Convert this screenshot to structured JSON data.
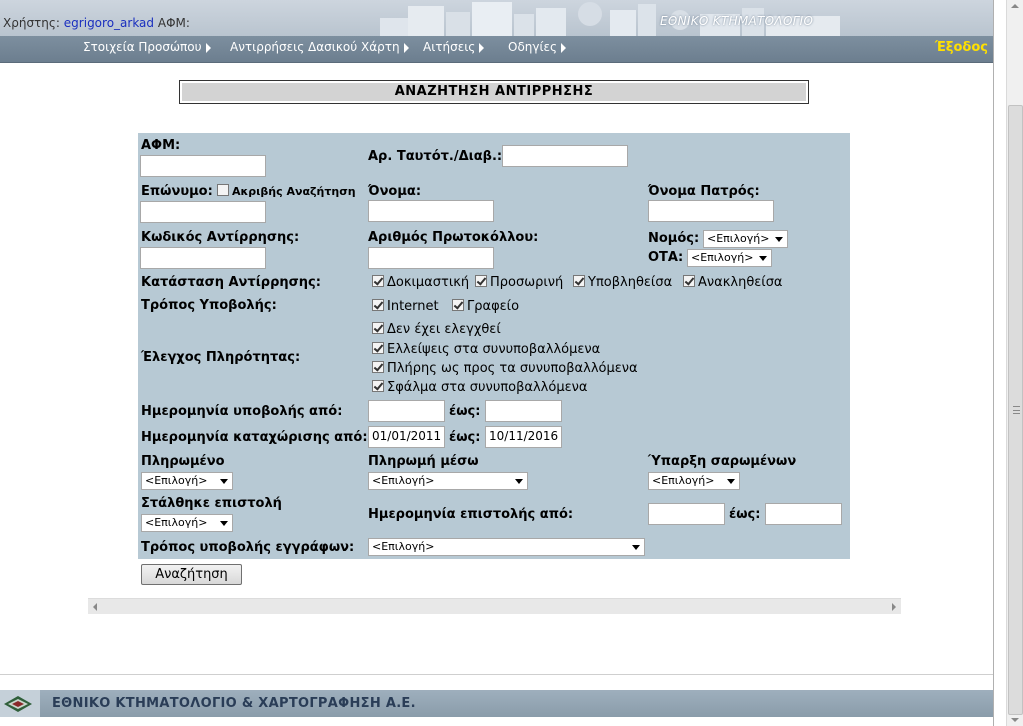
{
  "header": {
    "user_label": "Χρήστης:",
    "username": "egrigoro_arkad",
    "afm_label": "ΑΦΜ:",
    "brand": "ΕΘΝΙΚΟ ΚΤΗΜΑΤΟΛΟΓΙΟ"
  },
  "nav": {
    "items": [
      {
        "label": "Στοιχεία Προσώπου"
      },
      {
        "label": "Αντιρρήσεις Δασικού Χάρτη"
      },
      {
        "label": "Αιτήσεις"
      },
      {
        "label": "Οδηγίες"
      }
    ],
    "logout": "Έξοδος"
  },
  "title": "ΑΝΑΖΗΤΗΣΗ ΑΝΤΙΡΡΗΣΗΣ",
  "form": {
    "afm_label": "ΑΦΜ:",
    "id_label": "Αρ. Ταυτότ./Διαβ.:",
    "surname_label": "Επώνυμο:",
    "exact_search_label": "Ακριβής Αναζήτηση",
    "name_label": "Όνομα:",
    "father_label": "Όνομα Πατρός:",
    "objection_code_label": "Κωδικός Αντίρρησης:",
    "protocol_label": "Αριθμός Πρωτοκόλλου:",
    "nomos_label": "Νομός:",
    "ota_label": "ΟΤΑ:",
    "select_placeholder": "<Επιλογή>",
    "status_label": "Κατάσταση Αντίρρησης:",
    "status_options": [
      {
        "label": "Δοκιμαστική",
        "checked": true
      },
      {
        "label": "Προσωρινή",
        "checked": true
      },
      {
        "label": "Υποβληθείσα",
        "checked": true
      },
      {
        "label": "Ανακληθείσα",
        "checked": true
      }
    ],
    "submission_label": "Τρόπος Υποβολής:",
    "submission_options": [
      {
        "label": "Internet",
        "checked": true
      },
      {
        "label": "Γραφείο",
        "checked": true
      }
    ],
    "completeness_label": "Έλεγχος Πληρότητας:",
    "completeness_options": [
      {
        "label": "Δεν έχει ελεγχθεί",
        "checked": true
      },
      {
        "label": "Ελλείψεις στα συνυποβαλλόμενα",
        "checked": true
      },
      {
        "label": "Πλήρης ως προς τα συνυποβαλλόμενα",
        "checked": true
      },
      {
        "label": "Σφάλμα στα συνυποβαλλόμενα",
        "checked": true
      }
    ],
    "submit_date_from_label": "Ημερομηνία υποβολής από:",
    "to_label": "έως:",
    "reg_date_from_label": "Ημερομηνία καταχώρισης από:",
    "reg_date_from": "01/01/2011",
    "reg_date_to": "10/11/2016",
    "paid_label": "Πληρωμένο",
    "payment_via_label": "Πληρωμή μέσω",
    "scanned_label": "Ύπαρξη σαρωμένων",
    "letter_sent_label": "Στάλθηκε επιστολή",
    "letter_date_from_label": "Ημερομηνία επιστολής από:",
    "docs_submission_label": "Τρόπος υποβολής εγγράφων:",
    "search_button": "Αναζήτηση"
  },
  "footer": {
    "text": "ΕΘΝΙΚΟ ΚΤΗΜΑΤΟΛΟΓΙΟ & ΧΑΡΤΟΓΡΑΦΗΣΗ Α.Ε."
  },
  "colors": {
    "panel": "#b7c9d4",
    "nav": "#74879a",
    "logout": "#ffe000",
    "username": "#1a2fbf",
    "footer_text": "#2a3d57"
  }
}
